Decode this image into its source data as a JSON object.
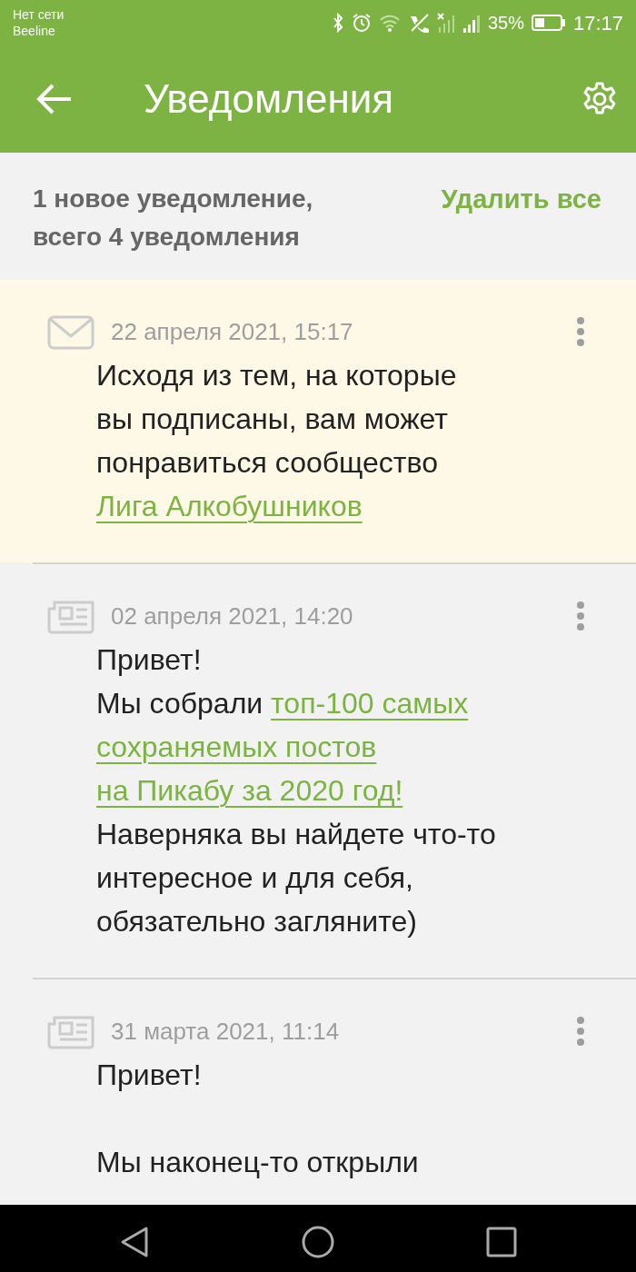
{
  "status_bar": {
    "network": "Нет сети",
    "carrier": "Beeline",
    "battery": "35%",
    "time": "17:17"
  },
  "toolbar": {
    "title": "Уведомления"
  },
  "summary": {
    "text_lines": [
      "1 новое уведомление,",
      "всего 4 уведомления"
    ],
    "delete_all": "Удалить все"
  },
  "notifications": [
    {
      "kind": "envelope",
      "unread": true,
      "date": "22 апреля 2021, 15:17",
      "paragraphs": [
        [
          [
            {
              "kind": "text",
              "text": "Исходя из тем, на которые"
            }
          ],
          [
            {
              "kind": "text",
              "text": "вы подписаны, вам может"
            }
          ],
          [
            {
              "kind": "text",
              "text": "понравиться сообщество"
            }
          ],
          [
            {
              "kind": "link",
              "text": "Лига Алкобушников"
            }
          ]
        ]
      ]
    },
    {
      "kind": "news",
      "unread": false,
      "date": "02 апреля 2021, 14:20",
      "paragraphs": [
        [
          [
            {
              "kind": "text",
              "text": "Привет!"
            }
          ],
          [
            {
              "kind": "text",
              "text": "Мы собрали "
            },
            {
              "kind": "link",
              "text": "топ-100 самых"
            }
          ],
          [
            {
              "kind": "link",
              "text": "сохраняемых постов"
            }
          ],
          [
            {
              "kind": "link",
              "text": "на Пикабу за 2020 год!"
            }
          ],
          [
            {
              "kind": "text",
              "text": "Наверняка вы найдете что-то"
            }
          ],
          [
            {
              "kind": "text",
              "text": "интересное и для себя,"
            }
          ],
          [
            {
              "kind": "text",
              "text": "обязательно загляните)"
            }
          ]
        ]
      ]
    },
    {
      "kind": "news",
      "unread": false,
      "date": "31 марта 2021, 11:14",
      "paragraphs": [
        [
          [
            {
              "kind": "text",
              "text": "Привет!"
            }
          ]
        ],
        [
          [
            {
              "kind": "text",
              "text": "Мы наконец-то открыли"
            }
          ]
        ]
      ]
    }
  ]
}
